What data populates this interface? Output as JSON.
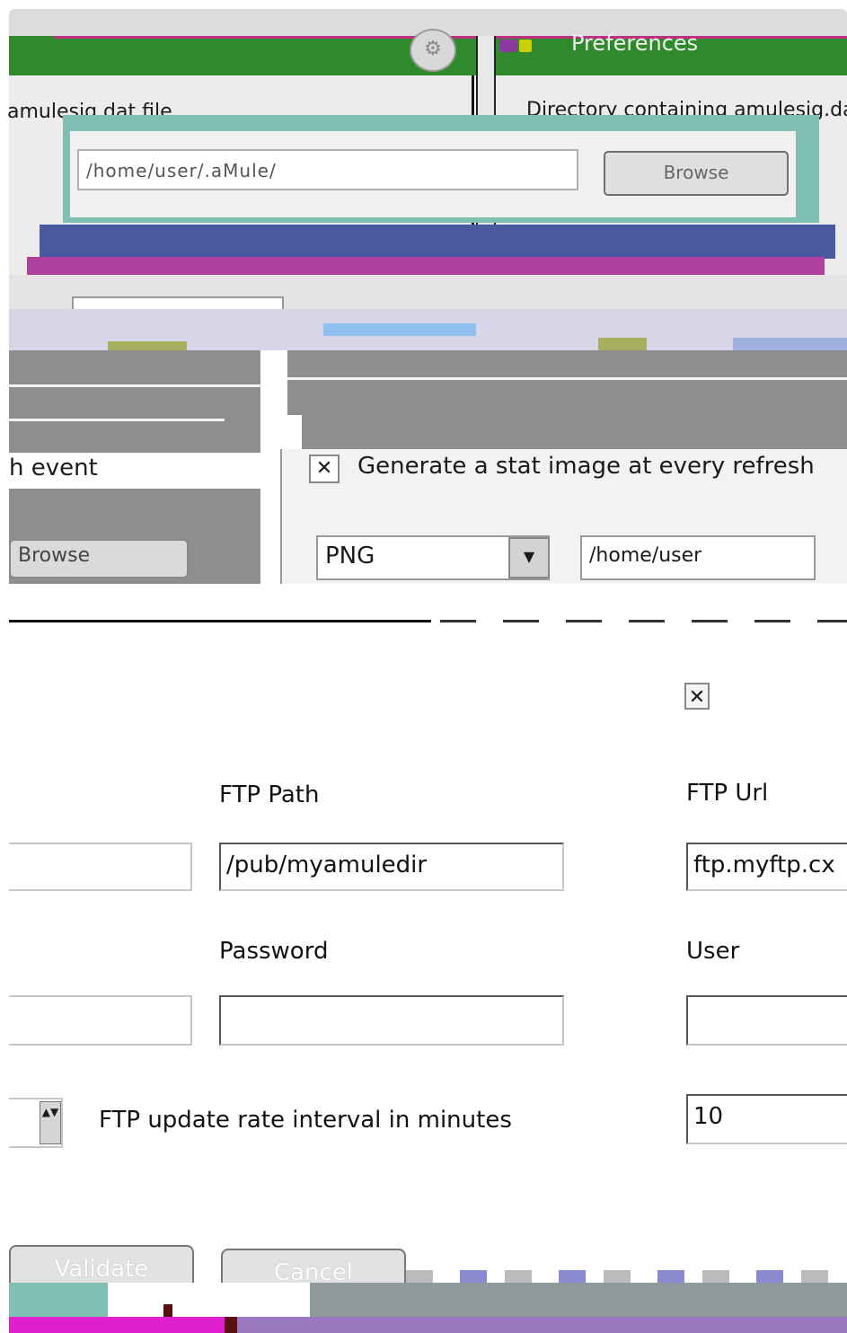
{
  "window": {
    "title": "Preferences",
    "gear_glyph": "⚙"
  },
  "aml_section": {
    "label": "amulesig.dat file",
    "directory_label": "Directory containing amulesig.dat",
    "path_value": "/home/user/.aMule/",
    "browse_label": "Browse"
  },
  "stat_section": {
    "refresh_event_label": "h event",
    "left_browse_label": "Browse",
    "generate_checked": "✕",
    "generate_label": "Generate a stat image at every refresh",
    "combo_value": "PNG",
    "combo_button": "▼",
    "path_value": "/home/user"
  },
  "ftp": {
    "enable_checked": "✕",
    "path_label": "FTP Path",
    "path_value": "/pub/myamuledir",
    "url_label": "FTP Url",
    "url_value": "ftp.myftp.cx",
    "password_label": "Password",
    "password_value": "",
    "user_label": "User",
    "user_value": "",
    "left_field1_value": "",
    "left_field2_value": "",
    "rate_label": "FTP update rate interval in minutes",
    "rate_value": "10",
    "spin_glyph": "▲▼"
  },
  "buttons": {
    "validate": "Validate",
    "cancel": "Cancel"
  }
}
